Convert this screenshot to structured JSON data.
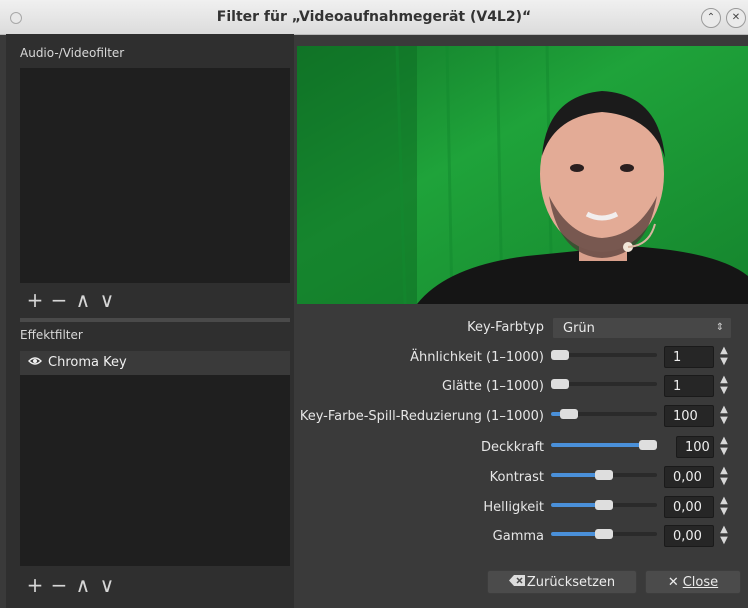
{
  "window": {
    "title": "Filter für „Videoaufnahmegerät (V4L2)“",
    "minimize_glyph": "⌃",
    "close_glyph": "✕"
  },
  "left": {
    "av_filters_label": "Audio-/Videofilter",
    "effect_filters_label": "Effektfilter",
    "tools": [
      "+",
      "−",
      "∧",
      "∨"
    ],
    "effect_items": [
      {
        "label": "Chroma Key",
        "icon": "eye-icon"
      }
    ]
  },
  "settings": {
    "key_color_type": {
      "label": "Key-Farbtyp",
      "value": "Grün"
    },
    "sliders": [
      {
        "label": "Ähnlichkeit (1–1000)",
        "value": "1",
        "fraction": 0.0
      },
      {
        "label": "Glätte (1–1000)",
        "value": "1",
        "fraction": 0.0
      },
      {
        "label": "Key-Farbe-Spill-Reduzierung (1–1000)",
        "value": "100",
        "fraction": 0.1
      },
      {
        "label": "Deckkraft",
        "value": "100",
        "fraction": 1.0
      },
      {
        "label": "Kontrast",
        "value": "0,00",
        "fraction": 0.5
      },
      {
        "label": "Helligkeit",
        "value": "0,00",
        "fraction": 0.5
      },
      {
        "label": "Gamma",
        "value": "0,00",
        "fraction": 0.5
      }
    ]
  },
  "buttons": {
    "reset": "Zurücksetzen",
    "close": "Close"
  },
  "colors": {
    "accent": "#4a90d9",
    "green_screen": "#1f9a35"
  }
}
